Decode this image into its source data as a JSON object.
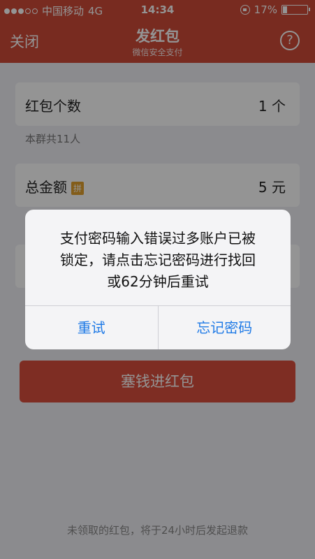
{
  "statusbar": {
    "carrier": "中国移动",
    "network": "4G",
    "time": "14:34",
    "battery": "17%",
    "battery_level": 0.17
  },
  "nav": {
    "close": "关闭",
    "title": "发红包",
    "subtitle": "微信安全支付",
    "help": "?"
  },
  "form": {
    "count_label": "红包个数",
    "count_value": "1 个",
    "group_hint": "本群共11人",
    "amount_label": "总金额",
    "pin_badge": "拼",
    "amount_value": "5 元"
  },
  "send_button": "塞钱进红包",
  "footer_note": "未领取的红包，将于24小时后发起退款",
  "alert": {
    "line1": "支付密码输入错误过多账户已被",
    "line2": "锁定，请点击忘记密码进行找回",
    "line3": "或62分钟后重试",
    "retry": "重试",
    "forgot": "忘记密码"
  }
}
